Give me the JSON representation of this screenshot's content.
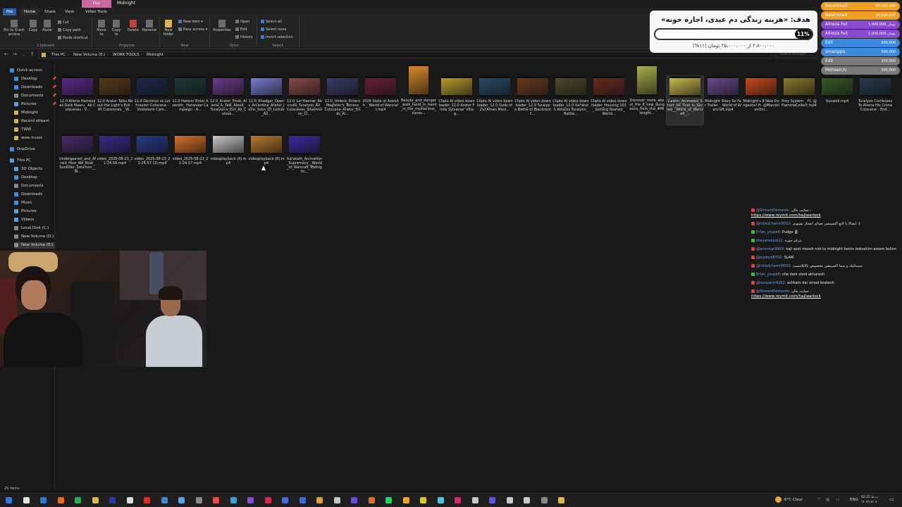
{
  "window": {
    "play_label": "Play",
    "title": "Midnight"
  },
  "menu_tabs": [
    "File",
    "Home",
    "Share",
    "View",
    "Video Tools"
  ],
  "ribbon": {
    "pin_label": "Pin to Quick access",
    "copy_label": "Copy",
    "paste_label": "Paste",
    "cut_label": "Cut",
    "copy_path_label": "Copy path",
    "paste_shortcut_label": "Paste shortcut",
    "move_to_label": "Move to",
    "copy_to_label": "Copy to",
    "delete_label": "Delete",
    "rename_label": "Rename",
    "new_folder_label": "New folder",
    "new_item_label": "New item",
    "easy_access_label": "Easy access",
    "properties_label": "Properties",
    "open_label": "Open",
    "edit_label": "Edit",
    "history_label": "History",
    "select_all_label": "Select all",
    "select_none_label": "Select none",
    "invert_selection_label": "Invert selection",
    "groups": [
      "Clipboard",
      "Organize",
      "New",
      "Open",
      "Select"
    ]
  },
  "address": {
    "crumbs": [
      "This PC",
      "New Volume (E:)",
      "WORK TOOLS",
      "Midnight"
    ],
    "search_placeholder": "Search Midnight"
  },
  "sidebar": {
    "items": [
      {
        "label": "Quick access",
        "icon": "star-icon",
        "pinned": false
      },
      {
        "label": "Desktop",
        "icon": "desktop-icon",
        "pinned": true
      },
      {
        "label": "Downloads",
        "icon": "download-icon",
        "pinned": true
      },
      {
        "label": "Documents",
        "icon": "documents-icon",
        "pinned": true
      },
      {
        "label": "Pictures",
        "icon": "pictures-icon",
        "pinned": true
      },
      {
        "label": "Midnight",
        "icon": "folder-icon",
        "pinned": false
      },
      {
        "label": "Record stream",
        "icon": "folder-icon",
        "pinned": false
      },
      {
        "label": "TWW",
        "icon": "folder-icon",
        "pinned": false
      },
      {
        "label": "wow music",
        "icon": "folder-icon",
        "pinned": false
      },
      {
        "label": "OneDrive",
        "icon": "cloud-icon",
        "pinned": false
      },
      {
        "label": "This PC",
        "icon": "computer-icon",
        "pinned": false
      },
      {
        "label": "3D Objects",
        "icon": "cube-icon",
        "pinned": false
      },
      {
        "label": "Desktop",
        "icon": "desktop-icon",
        "pinned": false
      },
      {
        "label": "Documents",
        "icon": "documents-icon",
        "pinned": false
      },
      {
        "label": "Downloads",
        "icon": "download-icon",
        "pinned": false
      },
      {
        "label": "Music",
        "icon": "music-icon",
        "pinned": false
      },
      {
        "label": "Pictures",
        "icon": "pictures-icon",
        "pinned": false
      },
      {
        "label": "Videos",
        "icon": "videos-icon",
        "pinned": false
      },
      {
        "label": "Local Disk (C:)",
        "icon": "drive-icon",
        "pinned": false
      },
      {
        "label": "New Volume (D:)",
        "icon": "drive-icon",
        "pinned": false
      },
      {
        "label": "New Volume (E:)",
        "icon": "drive-icon",
        "pinned": false
      }
    ]
  },
  "files": [
    {
      "name": "12.0 Alleria Harnesses Dark Naaru_ All Cutscenes - V...",
      "color": "#5a2a8a"
    },
    {
      "name": "12.0 Arator Talks About the Light's Evil - All Cutscenes _ W...",
      "color": "#5a3a1e"
    },
    {
      "name": "12.0 Decimus vs Lothraxion Cutscene - Voidstorm Cam...",
      "color": "#1e2a4a"
    },
    {
      "name": "12.0 Harenir Enter Azeroth_ Harandar Campaign - A...",
      "color": "#1e3a3a"
    },
    {
      "name": "12.0_Arator_Finds_Alleria_&_Talk_About_Turalyon's_Evil_All_Cutsce...",
      "color": "#6a3a8a"
    },
    {
      "name": "12.0_Khadgar_Opens_Arcantina_Arator_Joins_Sons_Of_Lothar_All...",
      "color": "#7a7ad0"
    },
    {
      "name": "12.0_Lor'themar_Recruits_Turalyon_All_Cutscenes_Silvermoon_Ci...",
      "color": "#8a4a4a"
    },
    {
      "name": "12.0_Umbric_Enters_Magister's_Terrace_Cutscene_Arator_Finds_Al...",
      "color": "#3a3a6a"
    },
    {
      "name": "2026 State of Azeroth _ World of Warcraft.mp4",
      "color": "#6a1e3a"
    },
    {
      "name": "Beauty_and_danger_walk_hand_in_hand_in_the_mysterious_zones...",
      "color": "#d88a2a"
    },
    {
      "name": "Clipto AI video downloader_12.0 Arator Finds Sylvanas' Villag...",
      "color": "#b89a2a"
    },
    {
      "name": "Clipto AI video downloader_12.0 Gods of Zul'Aman Movi...",
      "color": "#2a4a6a"
    },
    {
      "name": "Clipto AI video downloader_12.0 Turalyon Battle of Blackrock C...",
      "color": "#6a3a1e"
    },
    {
      "name": "Clipto AI video downloader_12.0 Xal'atath Attacks Turalyon_ Battle...",
      "color": "#4a4a2a"
    },
    {
      "name": "Clipto AI video downloader_Housing 101_ Getting Started _ World...",
      "color": "#6a2a1e"
    },
    {
      "name": "Discover_more_about_the_8_new_dungeons_from_the_#Midnight...",
      "color": "#a8b04a"
    },
    {
      "name": "Liadrin_Animated_Short_All_That_is_Sacred__World_of_Warcraft_...",
      "color": "#c8b84a"
    },
    {
      "name": "Midnight Story So Far Trailer _ World of Warcraft.mp4",
      "color": "#6a4a8a"
    },
    {
      "name": "Midnight's 8 New Dungeons! ft. @MarcelianOnl...",
      "color": "#c84a1e"
    },
    {
      "name": "Prey System _ Ft. @FiammaCollect.mp4",
      "color": "#8a7a2a"
    },
    {
      "name": "Sunwell.mp4",
      "color": "#3a5a2a"
    },
    {
      "name": "Turalyon Confesses To Alleria His Crime Cutscene - End...",
      "color": "#2a3a4a"
    },
    {
      "name": "Undergeared_and_Afraid_How_We_Beat_Sunkiller_Sanctum__W...",
      "color": "#4a2a6a"
    },
    {
      "name": "video_2025-08-23_21-24-56.mp4",
      "color": "#3a2a8a"
    },
    {
      "name": "video_2025-08-23_21-24-57 (2).mp4",
      "color": "#2a3a8a"
    },
    {
      "name": "video_2025-08-23_21-24-57.mp4",
      "color": "#d8702a"
    },
    {
      "name": "videoplayback (4).mp4",
      "color": "#c8c8c8"
    },
    {
      "name": "videoplayback (8).mp4",
      "color": "#b87a2a"
    },
    {
      "name": "Xal'atath_Animation_Supremacy__World_of_Warcraft_Midnight...",
      "color": "#3a2aa0"
    }
  ],
  "overlay": {
    "goal_text": "هدف: «هزینه زندگی دم عیدی، اجاره خونه»",
    "percent_label": "11%",
    "percent_value": 11,
    "amount_text": "۲،۸۰۰،۰۰۰ از ۲۵،۰۰۰،۰۰۰ تومان (۱۱%)"
  },
  "donations": [
    {
      "name": "NeutronaX",
      "amount": "20,000,000",
      "color": "#f0a020"
    },
    {
      "name": "NeutronaX",
      "amount": "10,000,000",
      "color": "#f0a020"
    },
    {
      "name": "Alireza hvt",
      "amount": "تومان 1,000,000",
      "color": "#8a4ad0"
    },
    {
      "name": "Alireza hvt",
      "amount": "تومان 1,000,000",
      "color": "#8a4ad0"
    },
    {
      "name": "Edil",
      "amount": "500,000",
      "color": "#3a8ae0"
    },
    {
      "name": "sinazippo",
      "amount": "500,000",
      "color": "#3a8ae0"
    },
    {
      "name": "Edil",
      "amount": "250,000",
      "color": "#7a7a7a"
    },
    {
      "name": "Mohsen.lv",
      "amount": "200,000",
      "color": "#7a7a7a"
    }
  ],
  "chat": [
    {
      "user": "@StreamElements:",
      "text": "حمایت مالی :",
      "link": "https://www.reymit.com/hajiwarlock",
      "dot": "#e04040"
    },
    {
      "user": "@miladcharmi9502:",
      "text": "ایشالا با لانچ اکسپنشن صدای انفجار بشنویم :)",
      "link": "",
      "dot": "#e04040"
    },
    {
      "user": "Erfan_yousefi:",
      "text": "Pudge 🗿",
      "link": "",
      "dot": "#30c040"
    },
    {
      "user": "shayansepai22:",
      "text": "بترکم جوزه",
      "link": "",
      "dot": "#30c040"
    },
    {
      "user": "@amirstar9999:",
      "text": "haji spot moosh nist to midnight berim bokoshim aroom bshim",
      "link": "",
      "dot": "#e04040"
    },
    {
      "user": "@jojolord8792:",
      "text": "SLAM",
      "link": "",
      "dot": "#e04040"
    },
    {
      "user": "@miladcharmi9502:",
      "text": "سینماتیک و سما اکسپنشن مخصوص بالاپلاتتست",
      "link": "",
      "dot": "#e04040"
    },
    {
      "user": "Erfan_yousefi:",
      "text": "che dark shod akharesh",
      "link": "",
      "dot": "#30c040"
    },
    {
      "user": "@rezazarin4262:",
      "text": "ashkam dar omad koskesh",
      "link": "",
      "dot": "#e04040"
    },
    {
      "user": "@StreamElements:",
      "text": "حمایت مالی :",
      "link": "https://www.reymit.com/hajiwarlock",
      "dot": "#e04040"
    }
  ],
  "status": {
    "item_count": "29 items"
  },
  "taskbar": {
    "weather": "6°C Clear",
    "lang": "ENG",
    "time": "02:25 ب.ظ",
    "date": "۱۴۰۴/۱۲/۰۷"
  }
}
